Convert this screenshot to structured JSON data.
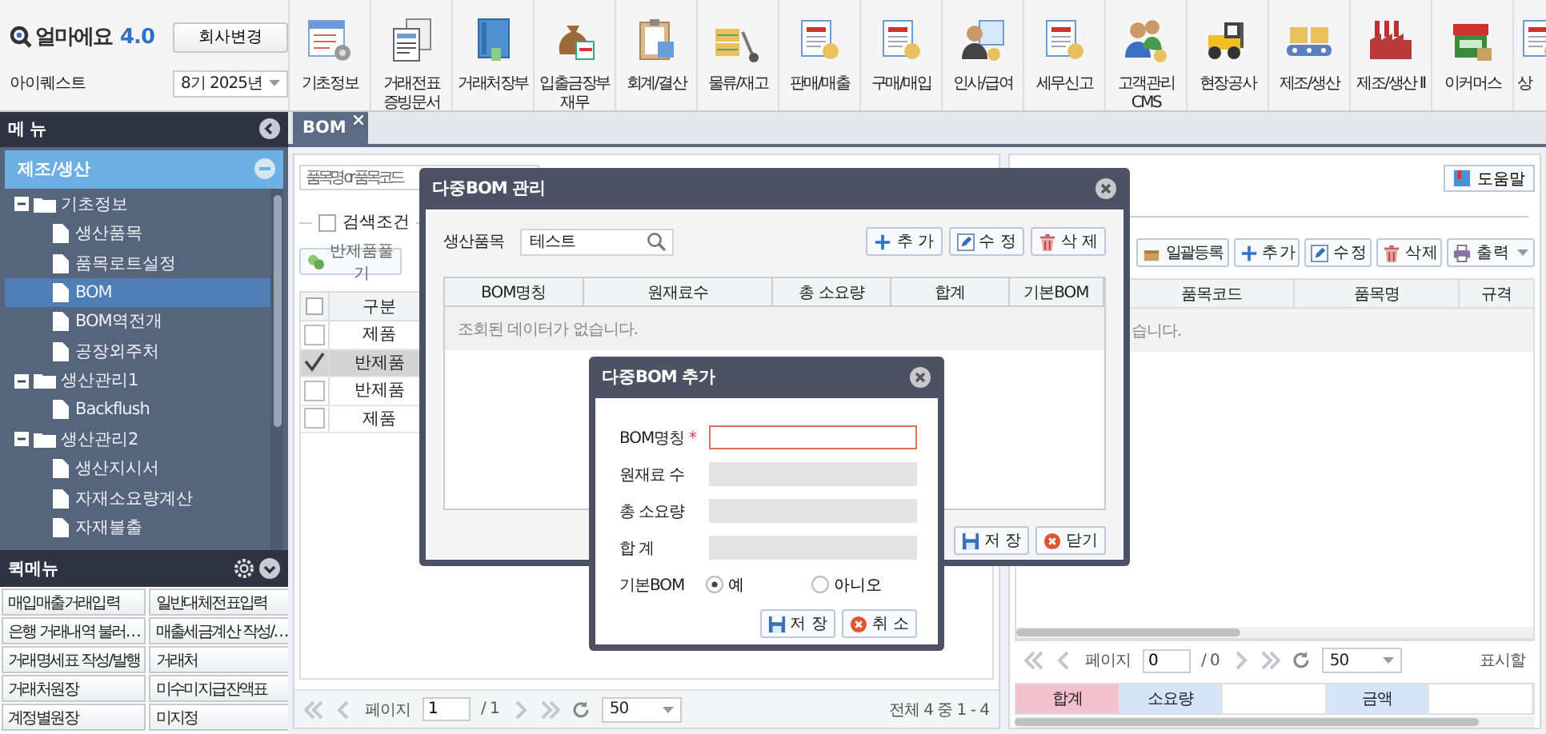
{
  "app": {
    "name": "얼마에요",
    "version": "4.0",
    "company_button": "회사변경",
    "user": "아이퀘스트",
    "period": "8기 2025년"
  },
  "toolbar": [
    {
      "lines": [
        "기초정보"
      ]
    },
    {
      "lines": [
        "거래전표",
        "증빙문서"
      ]
    },
    {
      "lines": [
        "거래처장부"
      ]
    },
    {
      "lines": [
        "입출금장부",
        "재무"
      ]
    },
    {
      "lines": [
        "회계/결산"
      ]
    },
    {
      "lines": [
        "물류/재고"
      ]
    },
    {
      "lines": [
        "판매/매출"
      ]
    },
    {
      "lines": [
        "구매/매입"
      ]
    },
    {
      "lines": [
        "인사/급여"
      ]
    },
    {
      "lines": [
        "세무신고"
      ]
    },
    {
      "lines": [
        "고객관리",
        "CMS"
      ]
    },
    {
      "lines": [
        "현장공사"
      ]
    },
    {
      "lines": [
        "제조/생산"
      ]
    },
    {
      "lines": [
        "제조/생산 II"
      ]
    },
    {
      "lines": [
        "이커머스"
      ]
    },
    {
      "lines": [
        "상"
      ]
    }
  ],
  "sidebar": {
    "title": "메 뉴",
    "section": {
      "label": "제조/생산",
      "expanded": true
    },
    "tree": [
      {
        "label": "기초정보",
        "expanded": true,
        "children": [
          {
            "label": "생산품목",
            "selected": false
          },
          {
            "label": "품목로트설정",
            "selected": false
          },
          {
            "label": "BOM",
            "selected": true
          },
          {
            "label": "BOM역전개",
            "selected": false
          },
          {
            "label": "공장외주처",
            "selected": false
          }
        ]
      },
      {
        "label": "생산관리1",
        "expanded": true,
        "children": [
          {
            "label": "Backflush",
            "selected": false
          }
        ]
      },
      {
        "label": "생산관리2",
        "expanded": true,
        "children": [
          {
            "label": "생산지시서",
            "selected": false
          },
          {
            "label": "자재소요량계산",
            "selected": false
          },
          {
            "label": "자재불출",
            "selected": false
          }
        ]
      }
    ]
  },
  "quick_menu": {
    "title": "퀵메뉴",
    "items": [
      "매입매출거래입력",
      "일반대체전표입력",
      "은행 거래내역 불러…",
      "매출세금계산 작성/…",
      "거래명세표 작성/발행",
      "거래처",
      "거래처원장",
      "미수미지급잔액표",
      "계정별원장",
      "미지정"
    ]
  },
  "tabs": [
    {
      "label": "BOM",
      "selected": true
    }
  ],
  "bom_panel": {
    "search": {
      "placeholder": "품목명 or 품목코드"
    },
    "filter": {
      "label": "검색조건",
      "checked": false
    },
    "button": "반제품풀기",
    "table": {
      "select_all_checked": false,
      "columns": [
        "구분"
      ],
      "rows": [
        {
          "type": "제품",
          "checked": false
        },
        {
          "type": "반제품",
          "checked": true
        },
        {
          "type": "반제품",
          "checked": false
        },
        {
          "type": "제품",
          "checked": false
        }
      ]
    },
    "pager": {
      "page_label": "페이지",
      "page": "1",
      "total_pages": "/ 1",
      "page_size": "50",
      "summary": "전체 4 중 1 - 4"
    }
  },
  "detail_panel": {
    "help_button": "도움말",
    "buttons": [
      {
        "label": "일괄등록",
        "kind": "upload"
      },
      {
        "label": "추 가",
        "kind": "add"
      },
      {
        "label": "수 정",
        "kind": "edit"
      },
      {
        "label": "삭 제",
        "kind": "delete"
      },
      {
        "label": "출 력",
        "kind": "print"
      }
    ],
    "table": {
      "columns": [
        "품목코드",
        "품목명",
        "규격"
      ],
      "empty_message": "습니다."
    },
    "pager": {
      "page_label": "페이지",
      "page": "0",
      "total_pages": "/ 0",
      "page_size": "50",
      "summary": "표시할"
    },
    "totals": [
      {
        "label": "합계",
        "kind": "title"
      },
      {
        "label": "소요량",
        "kind": "header"
      },
      {
        "kind": "value"
      },
      {
        "label": "금액",
        "kind": "header"
      },
      {
        "kind": "value"
      }
    ]
  },
  "bom_manager_dialog": {
    "title": "다중BOM 관리",
    "product_label": "생산품목",
    "product_value": "테스트",
    "buttons": [
      {
        "label": "추 가",
        "kind": "add"
      },
      {
        "label": "수 정",
        "kind": "edit"
      },
      {
        "label": "삭 제",
        "kind": "delete"
      }
    ],
    "table": {
      "columns": [
        "BOM명칭",
        "원재료수",
        "총 소요량",
        "합계",
        "기본BOM"
      ],
      "empty_message": "조회된 데이터가 없습니다."
    },
    "footer_buttons": [
      {
        "label": "저 장",
        "kind": "save"
      },
      {
        "label": "닫기",
        "kind": "close"
      }
    ]
  },
  "bom_add_dialog": {
    "title": "다중BOM 추가",
    "fields": [
      {
        "label": "BOM명칭",
        "required_mark": "*",
        "disabled": false
      },
      {
        "label": "원재료 수",
        "disabled": true
      },
      {
        "label": "총 소요량",
        "disabled": true
      },
      {
        "label": "합 계",
        "disabled": true
      }
    ],
    "default_bom": {
      "label": "기본BOM",
      "options": [
        {
          "label": "예",
          "selected": true
        },
        {
          "label": "아니오",
          "selected": false
        }
      ]
    },
    "buttons": [
      {
        "label": "저 장",
        "kind": "save"
      },
      {
        "label": "취 소",
        "kind": "cancel"
      }
    ]
  }
}
